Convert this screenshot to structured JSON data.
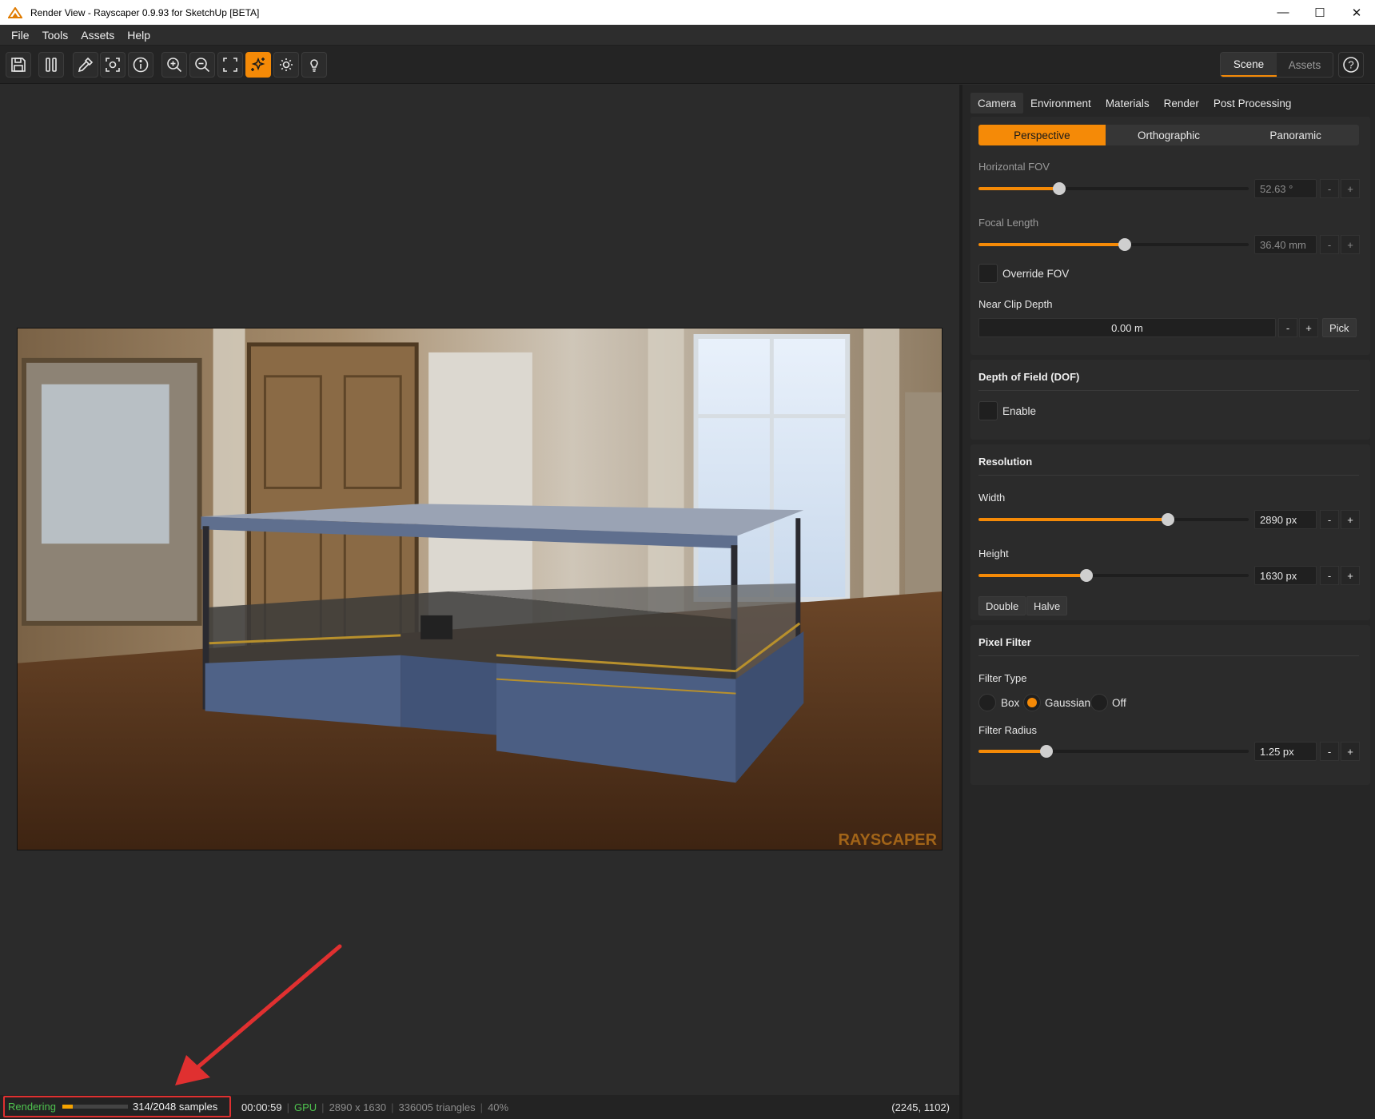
{
  "window": {
    "title": "Render View - Rayscaper 0.9.93 for SketchUp [BETA]",
    "minimize": "—",
    "maximize": "☐",
    "close": "✕"
  },
  "menu": [
    "File",
    "Tools",
    "Assets",
    "Help"
  ],
  "toolbar": {
    "buttons": [
      "save-icon",
      "pause-icon",
      "eyedropper-icon",
      "focus-icon",
      "info-icon",
      "zoom-in-icon",
      "zoom-out-icon",
      "fit-view-icon",
      "denoise-icon",
      "sun-icon",
      "light-bulb-icon"
    ],
    "active_button": "denoise-icon",
    "scene_tab": "Scene",
    "assets_tab": "Assets",
    "help": "?"
  },
  "render": {
    "watermark": "RAYSCAPER"
  },
  "status": {
    "state": "Rendering",
    "progress": 0.153,
    "samples": "314/2048 samples",
    "time": "00:00:59",
    "device": "GPU",
    "resolution": "2890 x 1630",
    "triangles": "336005 triangles",
    "zoom": "40%",
    "sep": "|",
    "coords": "(2245, 1102)"
  },
  "panel": {
    "tabs": [
      "Camera",
      "Environment",
      "Materials",
      "Render",
      "Post Processing"
    ],
    "active_tab": "Camera",
    "camera": {
      "projection": [
        "Perspective",
        "Orthographic",
        "Panoramic"
      ],
      "active_projection": "Perspective",
      "hfov_label": "Horizontal FOV",
      "hfov_value": "52.63 °",
      "hfov_level": 0.3,
      "focal_label": "Focal Length",
      "focal_value": "36.40 mm",
      "focal_level": 0.54,
      "override_fov": "Override FOV",
      "near_clip_label": "Near Clip Depth",
      "near_clip_value": "0.00 m",
      "pick": "Pick",
      "minus": "-",
      "plus": "+"
    },
    "dof": {
      "title": "Depth of Field (DOF)",
      "enable": "Enable"
    },
    "resolution": {
      "title": "Resolution",
      "width_label": "Width",
      "width_value": "2890 px",
      "width_level": 0.7,
      "height_label": "Height",
      "height_value": "1630 px",
      "height_level": 0.4,
      "double": "Double",
      "halve": "Halve"
    },
    "pixel_filter": {
      "title": "Pixel Filter",
      "filter_type_label": "Filter Type",
      "options": [
        "Box",
        "Gaussian",
        "Off"
      ],
      "selected": "Gaussian",
      "radius_label": "Filter Radius",
      "radius_value": "1.25 px",
      "radius_level": 0.25
    }
  },
  "colors": {
    "accent": "#f58a07",
    "rendering": "#4fc34f",
    "annotation": "#e03030"
  }
}
